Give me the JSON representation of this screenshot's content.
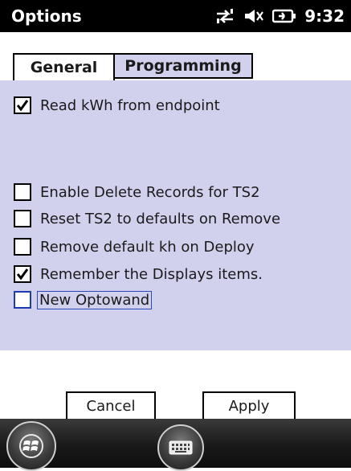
{
  "statusbar": {
    "title": "Options",
    "time": "9:32",
    "icons": [
      "connectivity-arrows-icon",
      "speaker-muted-icon",
      "battery-charging-icon"
    ]
  },
  "tabs": [
    {
      "label": "General",
      "active": false
    },
    {
      "label": "Programming",
      "active": true
    }
  ],
  "options": [
    {
      "label": "Read kWh from endpoint",
      "checked": true
    },
    {
      "label": "Enable Delete Records for TS2",
      "checked": false
    },
    {
      "label": "Reset TS2 to defaults on Remove",
      "checked": false
    },
    {
      "label": "Remove default kh on Deploy",
      "checked": false
    },
    {
      "label": "Remember the Displays items.",
      "checked": true
    },
    {
      "label": "New Optowand",
      "checked": false,
      "focused": true
    }
  ],
  "buttons": {
    "cancel": "Cancel",
    "apply": "Apply"
  },
  "taskbar": {
    "icons": [
      "windows-start-icon",
      "keyboard-icon"
    ]
  },
  "colors": {
    "panel": "#d1d1ee",
    "statusbar": "#000000",
    "focus": "#1b3bb0"
  }
}
